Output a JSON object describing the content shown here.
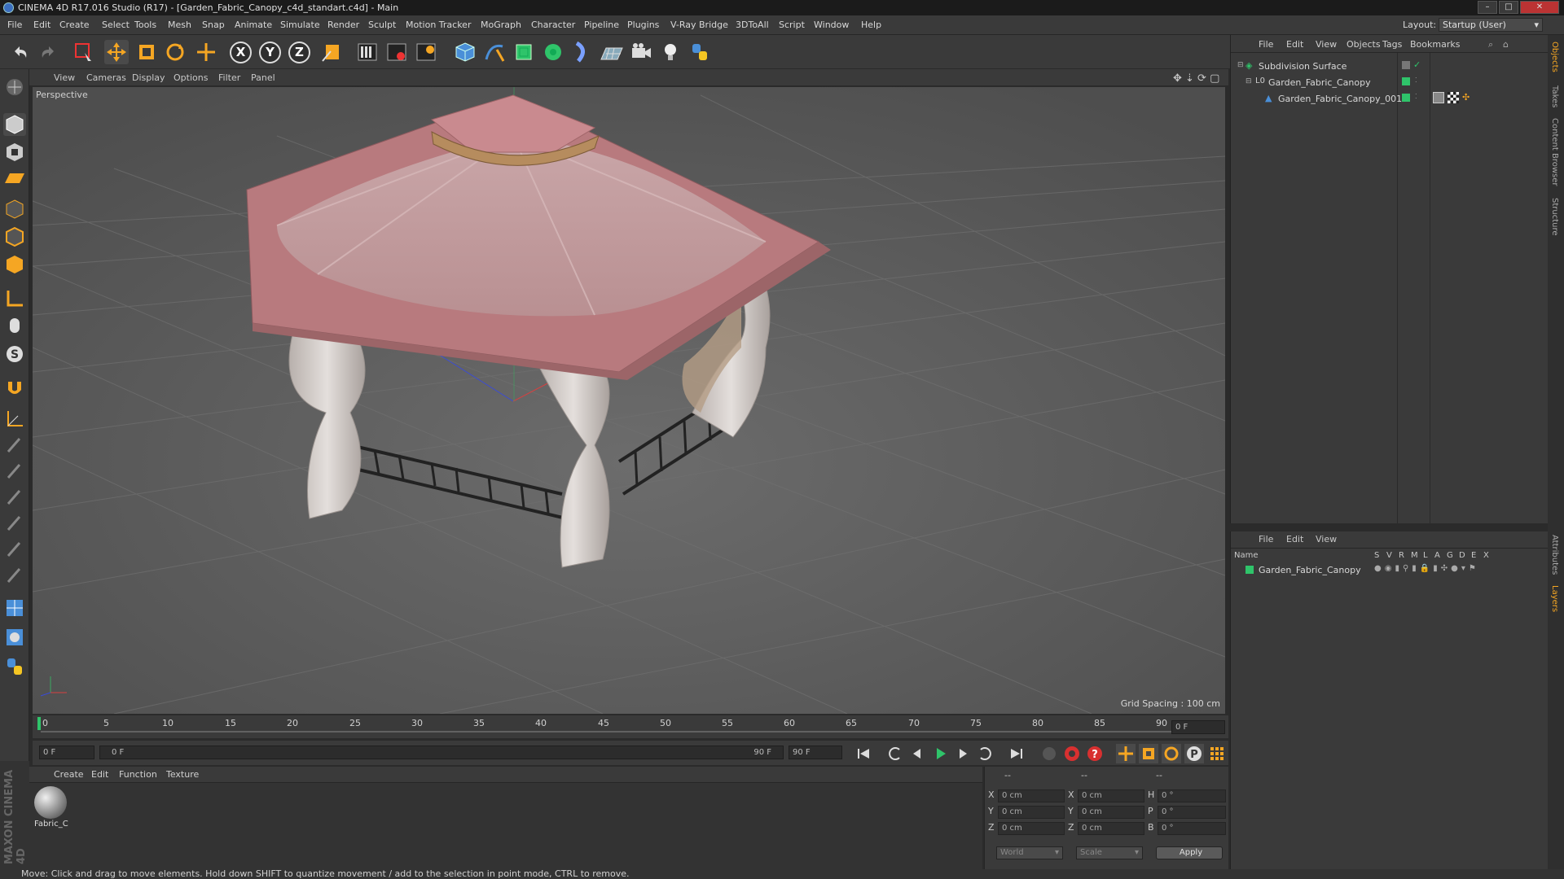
{
  "window": {
    "title": "CINEMA 4D R17.016 Studio (R17) - [Garden_Fabric_Canopy_c4d_standart.c4d] - Main"
  },
  "menubar": {
    "items": [
      "File",
      "Edit",
      "Create",
      "Select",
      "Tools",
      "Mesh",
      "Snap",
      "Animate",
      "Simulate",
      "Render",
      "Sculpt",
      "Motion Tracker",
      "MoGraph",
      "Character",
      "Pipeline",
      "Plugins",
      "V-Ray Bridge",
      "3DToAll",
      "Script",
      "Window",
      "Help"
    ],
    "layout_label": "Layout:",
    "layout_value": "Startup (User)"
  },
  "toolbar": {
    "axis_x": "X",
    "axis_y": "Y",
    "axis_z": "Z"
  },
  "viewport": {
    "menu": [
      "View",
      "Cameras",
      "Display",
      "Options",
      "Filter",
      "Panel"
    ],
    "label": "Perspective",
    "grid_spacing": "Grid Spacing : 100 cm"
  },
  "timeline": {
    "ticks": [
      "0",
      "5",
      "10",
      "15",
      "20",
      "25",
      "30",
      "35",
      "40",
      "45",
      "50",
      "55",
      "60",
      "65",
      "70",
      "75",
      "80",
      "85",
      "90"
    ],
    "current_frame_right": "0 F",
    "start_field": "0 F",
    "range_start": "0 F",
    "range_end": "90 F",
    "end_field": "90 F"
  },
  "material_manager": {
    "menu": [
      "Create",
      "Edit",
      "Function",
      "Texture"
    ],
    "materials": [
      {
        "name": "Fabric_C"
      }
    ]
  },
  "coordinates": {
    "header": [
      "--",
      "--",
      "--"
    ],
    "rows": [
      {
        "l1": "X",
        "v1": "0 cm",
        "l2": "X",
        "v2": "0 cm",
        "l3": "H",
        "v3": "0 °"
      },
      {
        "l1": "Y",
        "v1": "0 cm",
        "l2": "Y",
        "v2": "0 cm",
        "l3": "P",
        "v3": "0 °"
      },
      {
        "l1": "Z",
        "v1": "0 cm",
        "l2": "Z",
        "v2": "0 cm",
        "l3": "B",
        "v3": "0 °"
      }
    ],
    "mode1": "World",
    "mode2": "Scale",
    "apply": "Apply"
  },
  "object_manager": {
    "menu": [
      "File",
      "Edit",
      "View",
      "Objects",
      "Tags",
      "Bookmarks"
    ],
    "objects": [
      {
        "name": "Subdivision Surface"
      },
      {
        "name": "Garden_Fabric_Canopy"
      },
      {
        "name": "Garden_Fabric_Canopy_001"
      }
    ]
  },
  "layer_manager": {
    "menu": [
      "File",
      "Edit",
      "View"
    ],
    "col_name": "Name",
    "cols": [
      "S",
      "V",
      "R",
      "M",
      "L",
      "A",
      "G",
      "D",
      "E",
      "X"
    ],
    "layers": [
      {
        "name": "Garden_Fabric_Canopy"
      }
    ]
  },
  "side_tabs": [
    "Objects",
    "Takes",
    "Content Browser",
    "Structure",
    "Attributes",
    "Layers"
  ],
  "brand": "MAXON CINEMA 4D",
  "status": "Move: Click and drag to move elements. Hold down SHIFT to quantize movement / add to the selection in point mode, CTRL to remove.",
  "colors": {
    "accent": "#4a8fd8",
    "object_green": "#2fc46a",
    "canopy": "#c98a8f"
  }
}
